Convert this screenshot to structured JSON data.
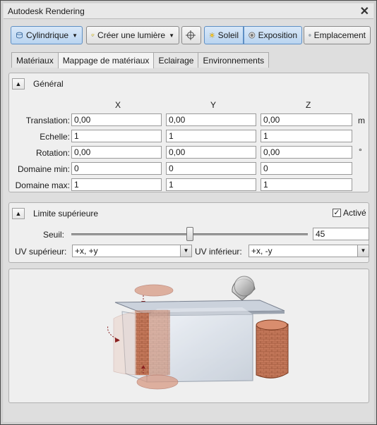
{
  "window": {
    "title": "Autodesk Rendering"
  },
  "toolbar": {
    "mapping_label": "Cylindrique",
    "create_light_label": "Créer une lumière",
    "sun_label": "Soleil",
    "exposure_label": "Exposition",
    "location_label": "Emplacement"
  },
  "tabs": [
    {
      "label": "Matériaux"
    },
    {
      "label": "Mappage de matériaux"
    },
    {
      "label": "Eclairage"
    },
    {
      "label": "Environnements"
    }
  ],
  "general": {
    "heading": "Général",
    "axes": [
      "X",
      "Y",
      "Z"
    ],
    "rows": [
      {
        "label": "Translation:",
        "values": [
          "0,00",
          "0,00",
          "0,00"
        ],
        "unit": "m"
      },
      {
        "label": "Echelle:",
        "values": [
          "1",
          "1",
          "1"
        ],
        "unit": ""
      },
      {
        "label": "Rotation:",
        "values": [
          "0,00",
          "0,00",
          "0,00"
        ],
        "unit": "°"
      },
      {
        "label": "Domaine min:",
        "values": [
          "0",
          "0",
          "0"
        ],
        "unit": ""
      },
      {
        "label": "Domaine max:",
        "values": [
          "1",
          "1",
          "1"
        ],
        "unit": ""
      }
    ]
  },
  "upper_limit": {
    "heading": "Limite supérieure",
    "active_label": "Activé",
    "active_checked": true,
    "threshold_label": "Seuil:",
    "threshold_value": "45",
    "threshold_fraction": 0.5,
    "uv_upper_label": "UV supérieur:",
    "uv_upper_value": "+x, +y",
    "uv_lower_label": "UV inférieur:",
    "uv_lower_value": "+x, -y"
  },
  "colors": {
    "accent": "#5e8fc4",
    "brick": "#b86a4a"
  }
}
